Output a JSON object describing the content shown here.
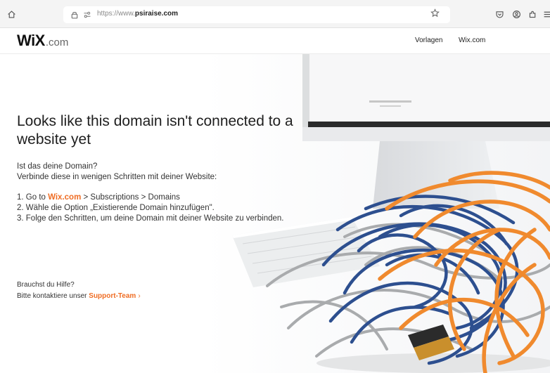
{
  "browser": {
    "url_prefix": "https://www.",
    "url_host": "psiraise.com",
    "icons": [
      "home-icon",
      "shield-icon",
      "lock-icon",
      "permissions-icon",
      "bookmark-star-icon",
      "pocket-icon",
      "account-icon",
      "extensions-icon",
      "menu-icon"
    ]
  },
  "header": {
    "logo_mark": "WiX",
    "logo_tld": ".com",
    "nav": [
      {
        "label": "Vorlagen"
      },
      {
        "label": "Wix.com"
      }
    ]
  },
  "main": {
    "headline": "Looks like this domain isn't connected to a website yet",
    "sub_line1": "Ist das deine Domain?",
    "sub_line2": "Verbinde diese in wenigen Schritten mit deiner Website:",
    "step1_prefix": "1. Go to ",
    "step1_link": "Wix.com",
    "step1_suffix": " > Subscriptions > Domains",
    "step2": "2. Wähle die Option „Existierende Domain hinzufügen\".",
    "step3": "3. Folge den Schritten, um deine Domain mit deiner Website zu verbinden."
  },
  "help": {
    "question": "Brauchst du Hilfe?",
    "contact_prefix": "Bitte kontaktiere unser ",
    "support_link": "Support-Team",
    "chevron": "›"
  },
  "colors": {
    "accent": "#ef6d24",
    "cable_blue": "#2d4f8f",
    "cable_orange": "#f08a2e",
    "cable_grey": "#a9abad"
  }
}
